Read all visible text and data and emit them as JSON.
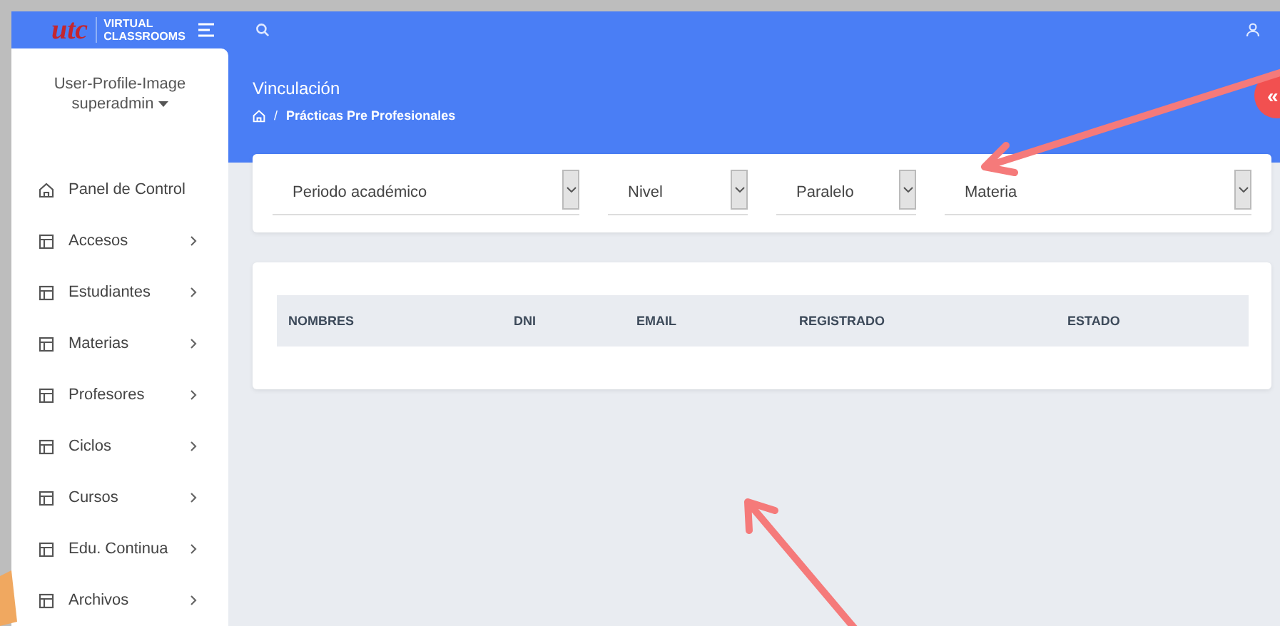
{
  "header": {
    "logo_mark": "utc",
    "logo_lines": [
      "VIRTUAL",
      "CLASSROOMS"
    ]
  },
  "sidebar": {
    "profile_image": "User-Profile-Image",
    "user": "superadmin",
    "items": [
      {
        "label": "Panel de Control",
        "kind": "home"
      },
      {
        "label": "Accesos",
        "kind": "submenu"
      },
      {
        "label": "Estudiantes",
        "kind": "submenu"
      },
      {
        "label": "Materias",
        "kind": "submenu"
      },
      {
        "label": "Profesores",
        "kind": "submenu"
      },
      {
        "label": "Ciclos",
        "kind": "submenu"
      },
      {
        "label": "Cursos",
        "kind": "submenu"
      },
      {
        "label": "Edu. Continua",
        "kind": "submenu"
      },
      {
        "label": "Archivos",
        "kind": "submenu"
      }
    ]
  },
  "page": {
    "title": "Vinculación",
    "separator": "/",
    "breadcrumb": "Prácticas Pre Profesionales"
  },
  "filters": [
    {
      "label": "Periodo académico"
    },
    {
      "label": "Nivel"
    },
    {
      "label": "Paralelo"
    },
    {
      "label": "Materia"
    }
  ],
  "table": {
    "columns": [
      "NOMBRES",
      "DNI",
      "EMAIL",
      "REGISTRADO",
      "ESTADO"
    ]
  },
  "collapse_button": "«"
}
